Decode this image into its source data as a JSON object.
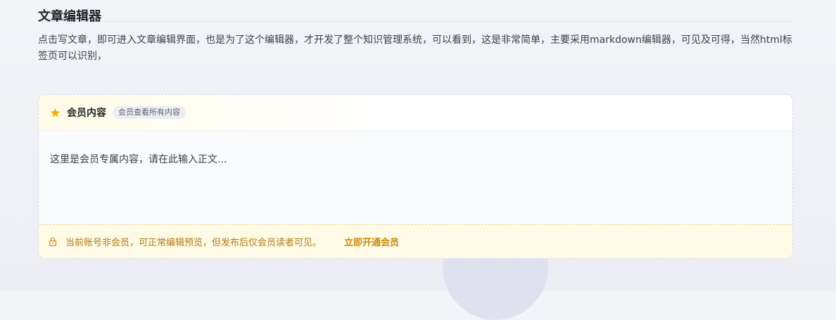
{
  "editor": {
    "title": "文章编辑器",
    "description": "点击写文章，即可进入文章编辑界面，也是为了这个编辑器，才开发了整个知识管理系统，可以看到，这是非常简单，主要采用markdown编辑器，可见及可得，当然html标签页可以识别，"
  },
  "member_card": {
    "icon": "star-icon",
    "title": "会员内容",
    "badge": "会员查看所有内容",
    "body": "这里是会员专属内容，请在此输入正文...",
    "notice": {
      "icon": "lock-icon",
      "text": "当前账号非会员，可正常编辑预览，但发布后仅会员读者可见。",
      "link": "立即开通会员"
    }
  },
  "colors": {
    "accent": "#f0b400",
    "notice_text": "#b07c12",
    "notice_link": "#c98a0b"
  }
}
